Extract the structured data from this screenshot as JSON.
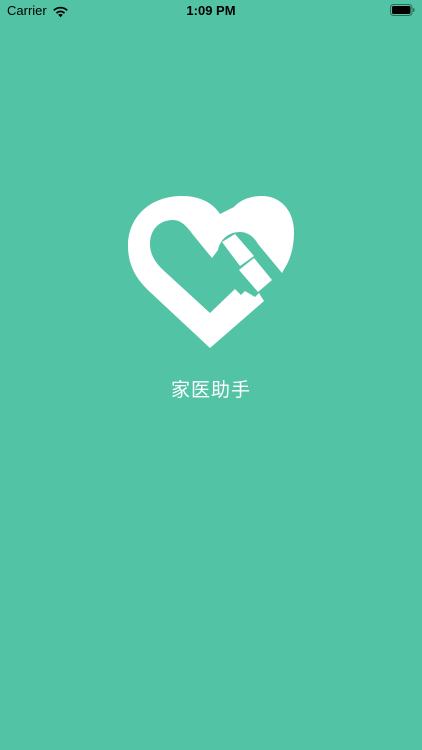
{
  "status_bar": {
    "carrier": "Carrier",
    "time": "1:09 PM",
    "signal_icon": "wifi-icon",
    "battery_icon": "battery-full-icon"
  },
  "splash": {
    "logo_icon": "heart-logo-icon",
    "app_name": "家医助手"
  },
  "colors": {
    "background": "#52C3A4",
    "foreground": "#FFFFFF",
    "status_text": "#000000"
  }
}
